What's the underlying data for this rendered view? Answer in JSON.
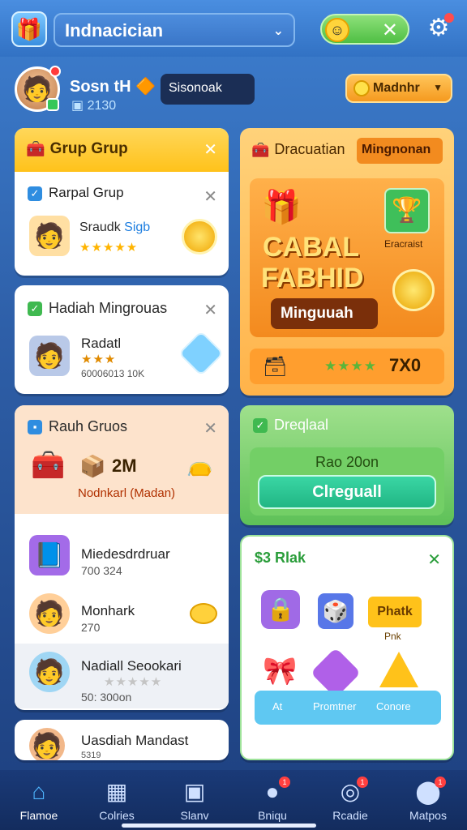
{
  "header": {
    "title": "Indnacician",
    "toggle_icon": "smiley-face-icon",
    "toggle_close": "✕"
  },
  "profile": {
    "name": "Sosn tH",
    "level": "2130",
    "search_label": "Sisonoak",
    "coin_button": "Madnhr"
  },
  "cards": {
    "grup": {
      "header": "Grup Grup",
      "item_title": "Rarpal Grup",
      "sub_title": "Sraudk",
      "sub_link": "Sigb",
      "stars": "★★★★★"
    },
    "hadiah": {
      "header": "Hadiah Mingrouas",
      "item_title": "Radatl",
      "stars": "★★★",
      "subtitle": "60006013 10K"
    },
    "raduh": {
      "header": "Rauh Gruos",
      "amount": "2M",
      "subtitle": "Nodnkarl (Madan)"
    },
    "list": [
      {
        "title": "Miedesdrdruar",
        "sub": "700 324"
      },
      {
        "title": "Monhark",
        "sub": "270"
      },
      {
        "title": "Nadiall Seookari",
        "sub": "50: 300on"
      },
      {
        "title": "Uasdiah Mandast",
        "sub": "5319"
      }
    ],
    "dracuatian": {
      "header": "Dracuatian",
      "tag": "Mingnonan",
      "promo_line1": "CABAL",
      "promo_line2": "FABHID",
      "promo_button": "Minguuah",
      "side_label": "Eracraist",
      "rating_value": "7X0",
      "stars": "★★★★"
    },
    "dreqlaal": {
      "header": "Dreqlaal",
      "text": "Rao 20on",
      "button": "Clreguall"
    },
    "rlak": {
      "header": "$3 Rlak",
      "tile_label": "Phatk",
      "tile_label2": "Pnk",
      "tab1": "At",
      "tab2": "Promtner",
      "tab3": "Conore"
    }
  },
  "nav": {
    "items": [
      {
        "label": "Flamoe",
        "icon": "home-icon"
      },
      {
        "label": "Colries",
        "icon": "grid-icon"
      },
      {
        "label": "Slanv",
        "icon": "box-icon"
      },
      {
        "label": "Bniqu",
        "icon": "chat-icon"
      },
      {
        "label": "Rcadie",
        "icon": "target-icon"
      },
      {
        "label": "Matpos",
        "icon": "pin-icon"
      }
    ]
  },
  "colors": {
    "accent": "#3a8fe0",
    "gold": "#f59a1f",
    "green": "#4fbf44"
  }
}
